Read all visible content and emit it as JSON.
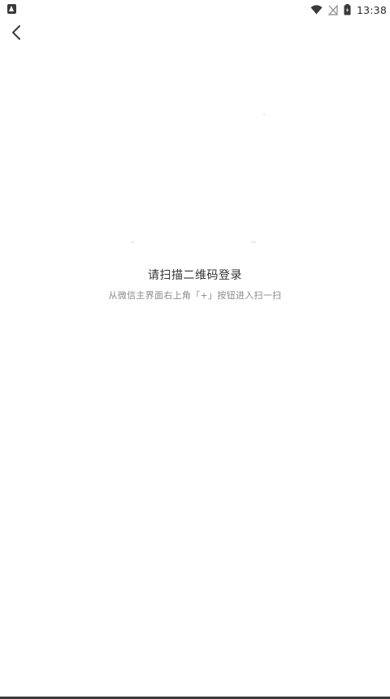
{
  "status_bar": {
    "time": "13:38",
    "icons": [
      "app-notification-icon",
      "wifi-icon",
      "signal-off-icon",
      "battery-icon"
    ]
  },
  "nav": {
    "back_icon": "chevron-left-icon"
  },
  "login": {
    "title": "请扫描二维码登录",
    "instruction": "从微信主界面右上角「+」按钮进入扫一扫"
  },
  "colors": {
    "background": "#ffffff",
    "title_text": "#333333",
    "instruction_text": "#8a8a8a",
    "icon": "#3a3a3a"
  }
}
